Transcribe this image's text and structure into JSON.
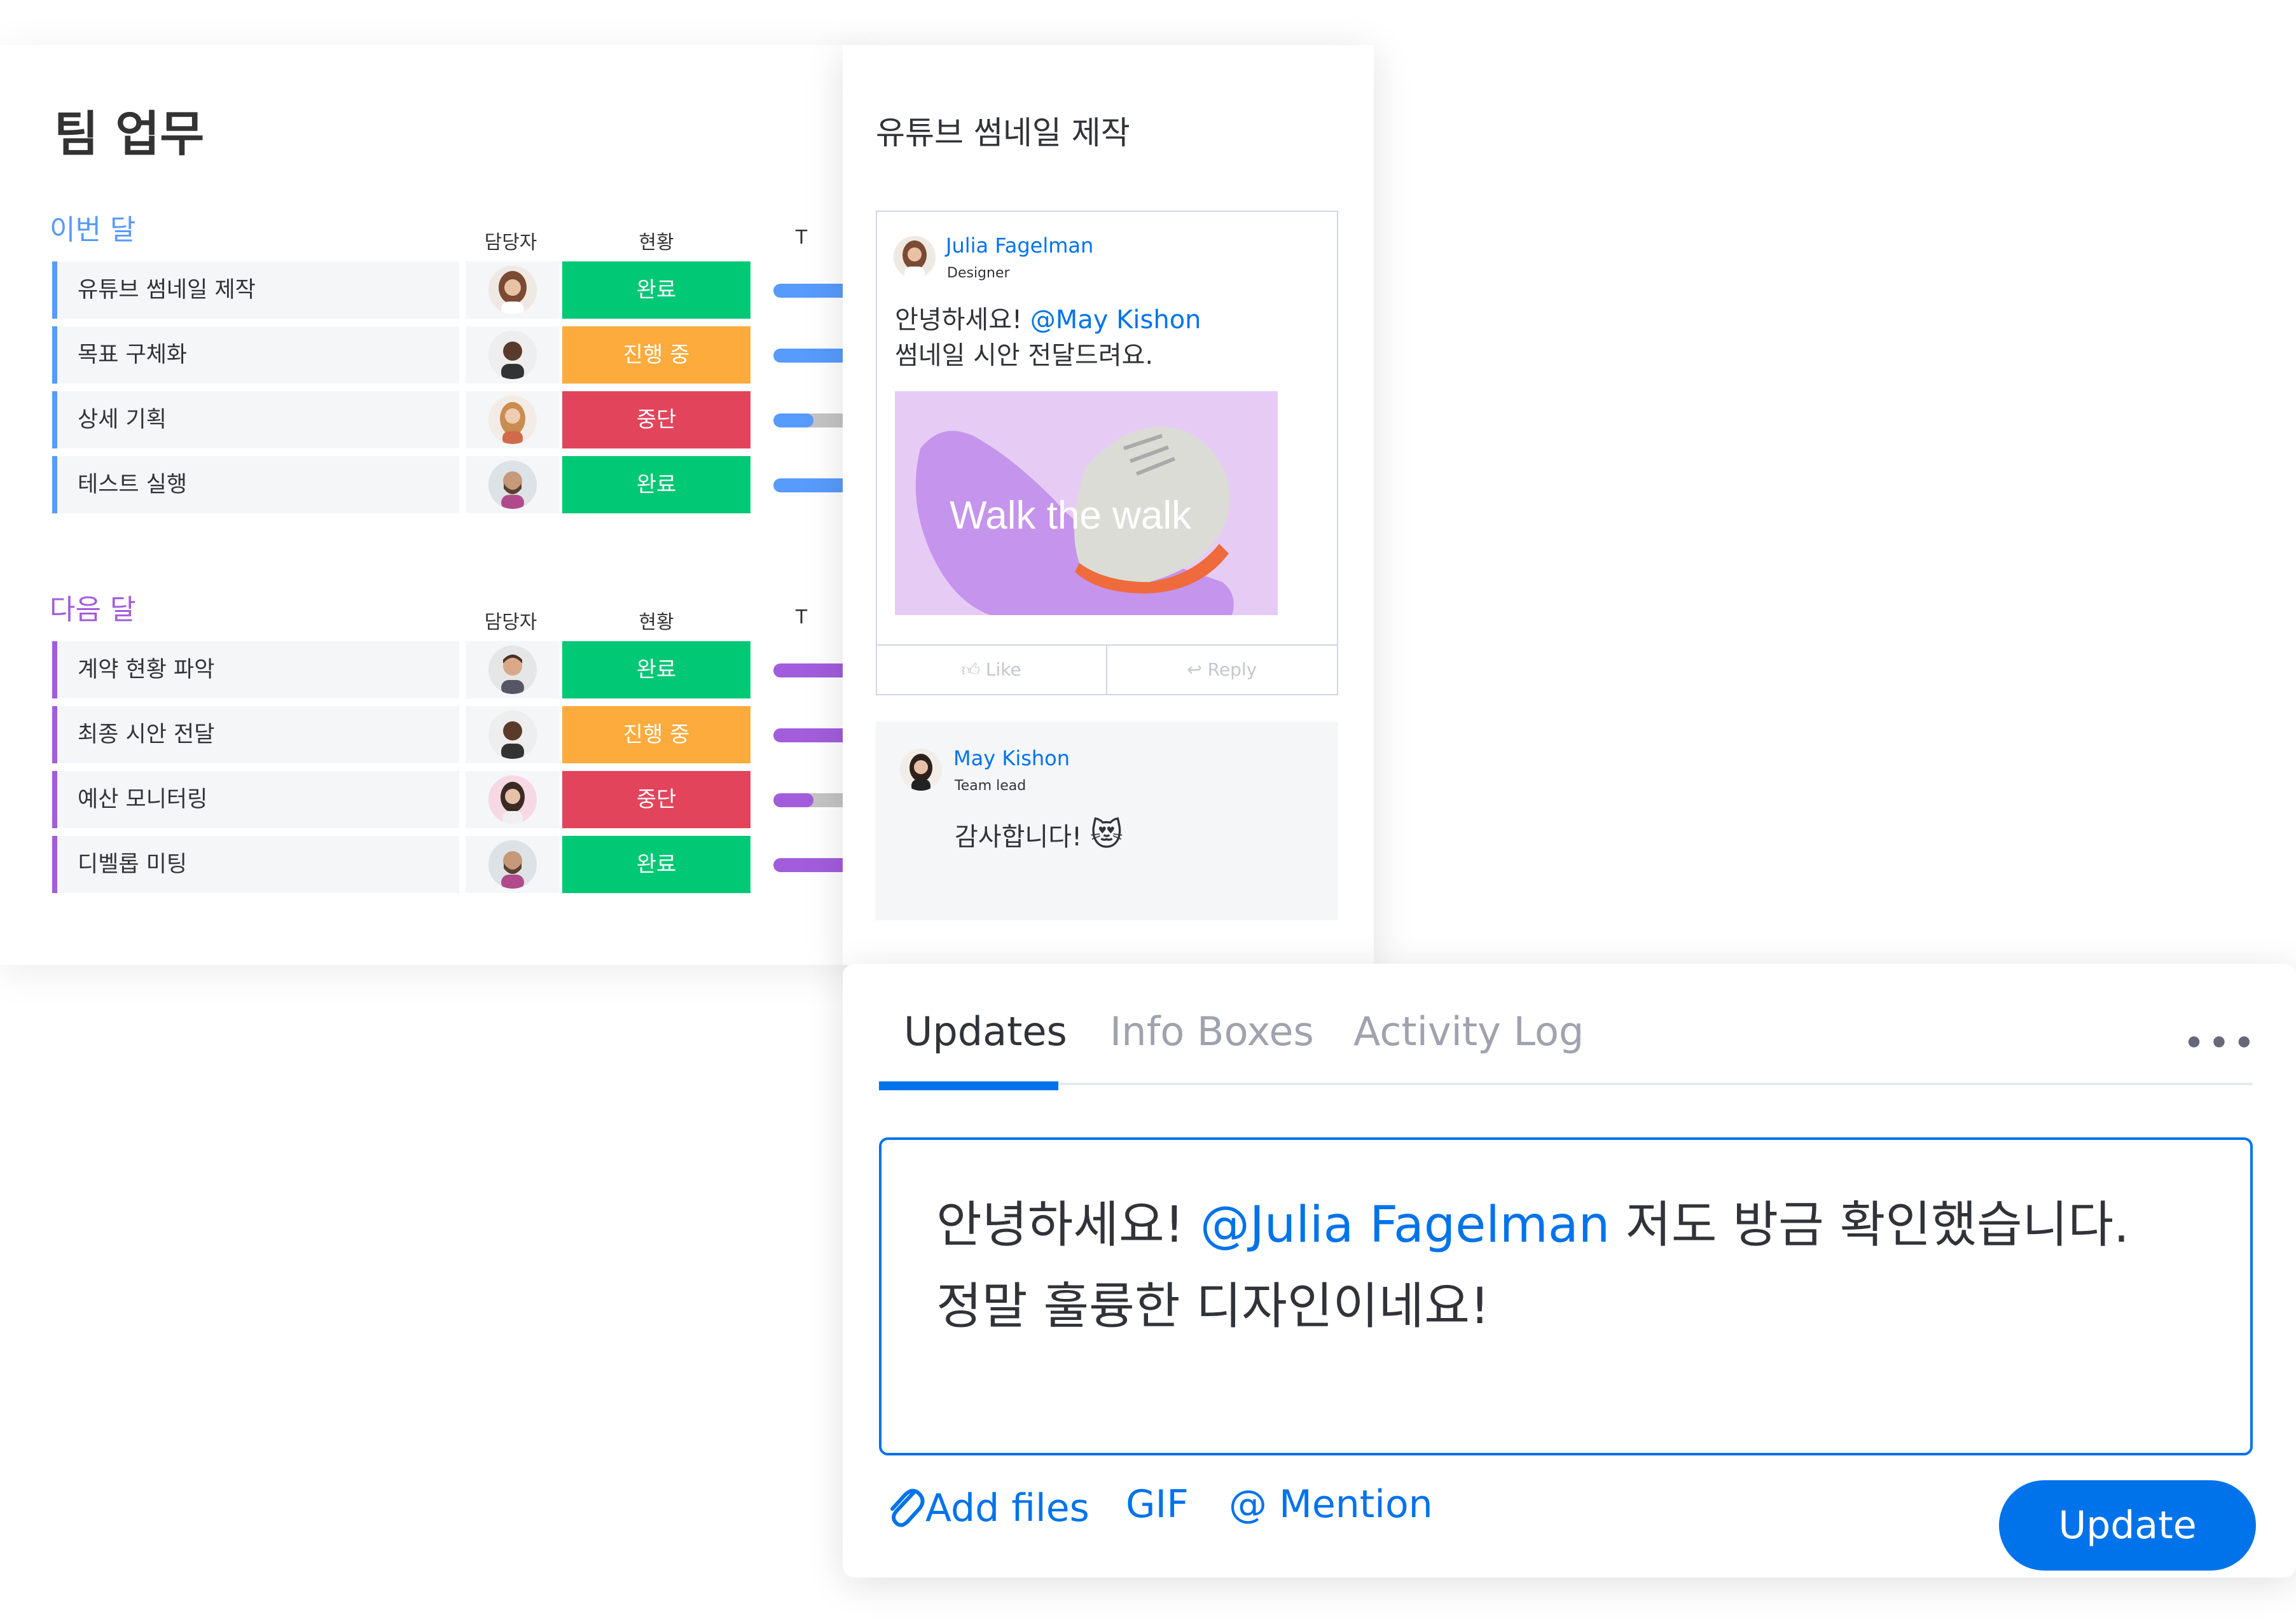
{
  "board": {
    "title": "팀 업무",
    "groups": [
      {
        "title": "이번 달",
        "color": "#579bfc",
        "col_owner": "담당자",
        "col_status": "현황",
        "col_timeline": "T",
        "rows": [
          {
            "name": "유튜브 썸네일 제작",
            "status": "완료",
            "status_color": "#00c875",
            "progress": 1.0
          },
          {
            "name": "목표 구체화",
            "status": "진행 중",
            "status_color": "#fdab3d",
            "progress": 1.0
          },
          {
            "name": "상세 기획",
            "status": "중단",
            "status_color": "#e2445c",
            "progress": 0.35
          },
          {
            "name": "테스트 실행",
            "status": "완료",
            "status_color": "#00c875",
            "progress": 1.0
          }
        ]
      },
      {
        "title": "다음 달",
        "color": "#a25ddc",
        "col_owner": "담당자",
        "col_status": "현황",
        "col_timeline": "T",
        "rows": [
          {
            "name": "계약 현황 파악",
            "status": "완료",
            "status_color": "#00c875",
            "progress": 1.0
          },
          {
            "name": "최종 시안 전달",
            "status": "진행 중",
            "status_color": "#fdab3d",
            "progress": 1.0
          },
          {
            "name": "예산 모니터링",
            "status": "중단",
            "status_color": "#e2445c",
            "progress": 0.35
          },
          {
            "name": "디벨롭 미팅",
            "status": "완료",
            "status_color": "#00c875",
            "progress": 1.0
          }
        ]
      }
    ]
  },
  "item": {
    "title": "유튜브 썸네일 제작",
    "post": {
      "author": "Julia Fagelman",
      "role": "Designer",
      "text_line1_prefix": "안녕하세요! ",
      "text_line1_mention": "@May Kishon",
      "text_line2": "썸네일 시안 전달드려요.",
      "image_caption": "Walk the walk",
      "like_label": "Like",
      "reply_label": "Reply"
    },
    "reply": {
      "author": "May Kishon",
      "role": "Team lead",
      "text": "감사합니다!",
      "emoji": "😻"
    }
  },
  "updates": {
    "tabs": [
      {
        "label": "Updates",
        "active": true
      },
      {
        "label": "Info Boxes",
        "active": false
      },
      {
        "label": "Activity Log",
        "active": false
      }
    ],
    "more_icon": "more-dots-icon",
    "editor": {
      "line1_prefix": "안녕하세요! ",
      "line1_mention": "@Julia Fagelman",
      "line1_suffix": " 저도 방금 확인했습니다.",
      "line2": "정말 훌륭한 디자인이네요!"
    },
    "toolbar": {
      "add_files": "Add files",
      "gif": "GIF",
      "mention": "@ Mention"
    },
    "update_button": "Update",
    "accent_color": "#0073ea"
  }
}
